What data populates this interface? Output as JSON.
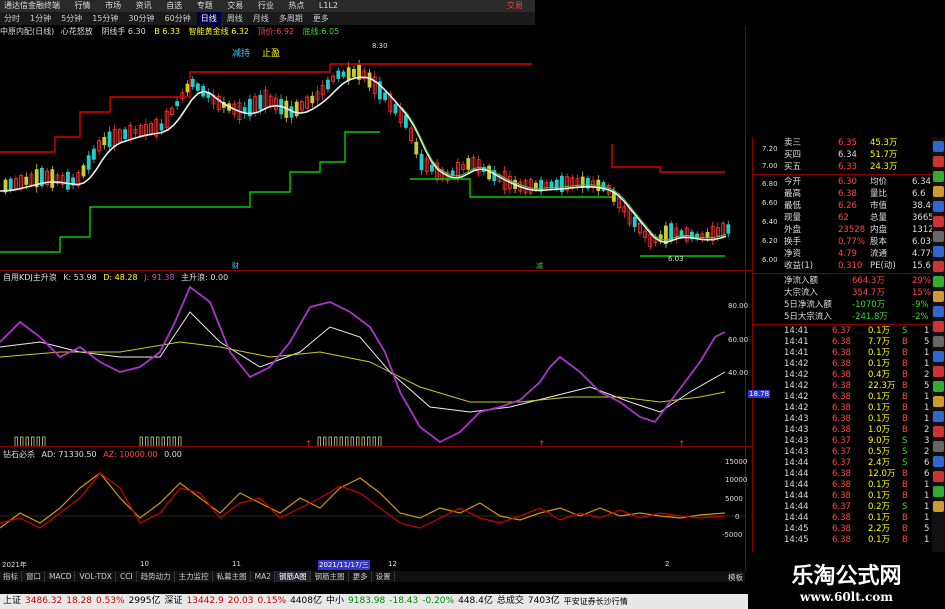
{
  "titlebar": {
    "app": "通达信金融终端",
    "menus": [
      "行情",
      "市场",
      "资讯",
      "自选",
      "专题",
      "交易",
      "行业",
      "热点",
      "L1L2"
    ],
    "right": "交易"
  },
  "periods": [
    "分时",
    "1分钟",
    "5分钟",
    "15分钟",
    "30分钟",
    "60分钟",
    "日线",
    "周线",
    "月线",
    "多周期",
    "更多"
  ],
  "period_active": "日线",
  "info": {
    "stock": "中原内配(日线)",
    "ind1": "心花怒放",
    "ind1b": "阴线手",
    "ind1v": "6.30",
    "ind1c": "B",
    "ind1cv": "6.33",
    "ind2": "智能黄金线",
    "ind2v": "6.32",
    "ind3": "顶价:6.92",
    "ind4": "底线:6.05"
  },
  "annot": {
    "a1": "减持",
    "a2": "止盈",
    "hi": "8.30",
    "lo": "6.03",
    "m1": "财",
    "m2": "减"
  },
  "kdj": {
    "title": "自用KDJ主升浪",
    "k": "K: 53.98",
    "d": "D: 48.28",
    "j": "J: 91.38",
    "zs": "主升浪: 0.00",
    "y80": "80.00",
    "y60": "60.00",
    "y40": "40.00",
    "y20": "18.78"
  },
  "bk": {
    "title": "钻石必杀",
    "ad": "AD: 71330.50",
    "az": "AZ: 10000.00",
    "v0": "0.00",
    "y15000": "15000",
    "y10000": "10000",
    "y5000": "5000",
    "y0": "0",
    "yn5000": "-5000"
  },
  "dates": {
    "d1": "2021年",
    "d2": "10",
    "d3": "11",
    "d4": "2021/11/17/三",
    "d5": "12",
    "d6": "2"
  },
  "price_axis": [
    "7.20",
    "7.00",
    "6.80",
    "6.60",
    "6.40",
    "6.20",
    "6.00"
  ],
  "quote": [
    [
      "卖三",
      "6.35",
      "45.3万"
    ],
    [
      "买四",
      "6.34",
      "51.7万"
    ],
    [
      "买五",
      "6.33",
      "24.3万"
    ]
  ],
  "stats": [
    [
      "今开",
      "6.30",
      "均价",
      "6.34"
    ],
    [
      "最高",
      "6.38",
      "量比",
      "6.6"
    ],
    [
      "最低",
      "6.26",
      "市值",
      "38.4亿"
    ],
    [
      "现量",
      "62",
      "总量",
      "36655"
    ],
    [
      "外盘",
      "23528",
      "内盘",
      "13127"
    ],
    [
      "换手",
      "0.77%",
      "股本",
      "6.03亿"
    ],
    [
      "净资",
      "4.79",
      "流通",
      "4.77亿"
    ],
    [
      "收益(1)",
      "0.310",
      "PE(动)",
      "15.6"
    ]
  ],
  "flows": [
    [
      "净流入额",
      "664.3万",
      "29%"
    ],
    [
      "大宗流入",
      "354.7万",
      "15%"
    ],
    [
      "5日净流入额",
      "-1070万",
      "-9%"
    ],
    [
      "5日大宗流入",
      "-241.8万",
      "-2%"
    ]
  ],
  "ticks": [
    [
      "14:41",
      "6.37",
      "0.1万",
      "S",
      "1"
    ],
    [
      "14:41",
      "6.38",
      "7.7万",
      "B",
      "5"
    ],
    [
      "14:41",
      "6.38",
      "0.1万",
      "B",
      "1"
    ],
    [
      "14:42",
      "6.38",
      "0.1万",
      "B",
      "1"
    ],
    [
      "14:42",
      "6.38",
      "0.4万",
      "B",
      "2"
    ],
    [
      "14:42",
      "6.38",
      "22.3万",
      "B",
      "5"
    ],
    [
      "14:42",
      "6.38",
      "0.1万",
      "B",
      "1"
    ],
    [
      "14:42",
      "6.38",
      "0.1万",
      "B",
      "1"
    ],
    [
      "14:43",
      "6.38",
      "0.1万",
      "B",
      "1"
    ],
    [
      "14:43",
      "6.38",
      "1.0万",
      "B",
      "2"
    ],
    [
      "14:43",
      "6.37",
      "9.0万",
      "S",
      "3"
    ],
    [
      "14:43",
      "6.37",
      "0.5万",
      "S",
      "2"
    ],
    [
      "14:44",
      "6.37",
      "2.4万",
      "S",
      "6"
    ],
    [
      "14:44",
      "6.38",
      "12.0万",
      "B",
      "6"
    ],
    [
      "14:44",
      "6.38",
      "0.1万",
      "B",
      "1"
    ],
    [
      "14:44",
      "6.38",
      "0.1万",
      "B",
      "1"
    ],
    [
      "14:44",
      "6.37",
      "0.2万",
      "S",
      "1"
    ],
    [
      "14:44",
      "6.38",
      "0.1万",
      "B",
      "1"
    ],
    [
      "14:45",
      "6.38",
      "2.2万",
      "B",
      "5"
    ],
    [
      "14:45",
      "6.38",
      "0.1万",
      "B",
      "1"
    ]
  ],
  "tabs": [
    "指标",
    "窗口",
    "MACD",
    "VOL-TDX",
    "CCI",
    "趋势动力",
    "主力监控",
    "私募主图",
    "MA2",
    "钢筋A图",
    "钢筋主图",
    "更多",
    "设置"
  ],
  "tab_right": "模板",
  "status": {
    "sh": "上证",
    "sh_v": "3486.32",
    "sh_c": "18.28",
    "sh_p": "0.53%",
    "sh_a": "2995亿",
    "sz": "深证",
    "sz_v": "13442.9",
    "sz_c": "20.03",
    "sz_p": "0.15%",
    "sz_a": "4408亿",
    "zx": "中小",
    "zx_v": "9183.98",
    "zx_c": "-18.43",
    "zx_p": "-0.20%",
    "zx_a": "448.4亿",
    "zcj": "总成交",
    "zcj_v": "7403亿",
    "broker": "平安证券长沙行情"
  },
  "watermark": {
    "cn": "乐淘公式网",
    "url": "www.60lt.com"
  }
}
